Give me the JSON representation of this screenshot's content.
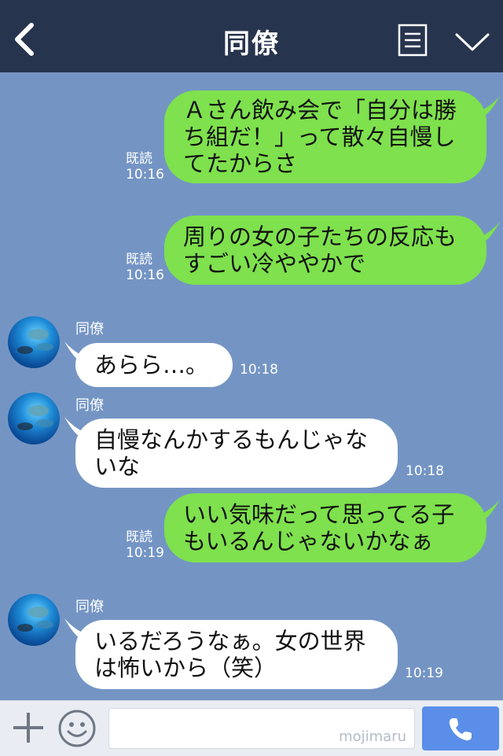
{
  "header": {
    "title": "同僚",
    "back_icon": "chevron-left-icon",
    "menu_icon": "menu-lines-icon",
    "collapse_icon": "chevron-down-icon"
  },
  "messages": [
    {
      "type": "sent",
      "text": "Ａさん飲み会で「自分は勝\nち組だ！」って散々自慢し\nてたからさ",
      "read": "既読",
      "time": "10:16"
    },
    {
      "type": "sent",
      "text": "周りの女の子たちの反応も\nすごい冷ややかで",
      "read": "既読",
      "time": "10:16"
    },
    {
      "type": "recv",
      "sender": "同僚",
      "text": "あらら…。",
      "time": "10:18"
    },
    {
      "type": "recv",
      "sender": "同僚",
      "text": "自慢なんかするもんじゃな\nいな",
      "time": "10:18"
    },
    {
      "type": "sent",
      "text": "いい気味だって思ってる子\nもいるんじゃないかなぁ",
      "read": "既読",
      "time": "10:19"
    },
    {
      "type": "recv",
      "sender": "同僚",
      "text": "いるだろうなぁ。女の世界\nは怖いから（笑）",
      "time": "10:19"
    }
  ],
  "footer": {
    "input_value": "",
    "watermark": "mojimaru",
    "plus_icon": "plus-icon",
    "smile_icon": "smile-icon",
    "call_icon": "phone-icon"
  },
  "colors": {
    "header_bg": "#27344d",
    "chat_bg": "#7495c4",
    "sent_bubble": "#7ee14d",
    "recv_bubble": "#ffffff",
    "call_button": "#5a8ee8"
  }
}
